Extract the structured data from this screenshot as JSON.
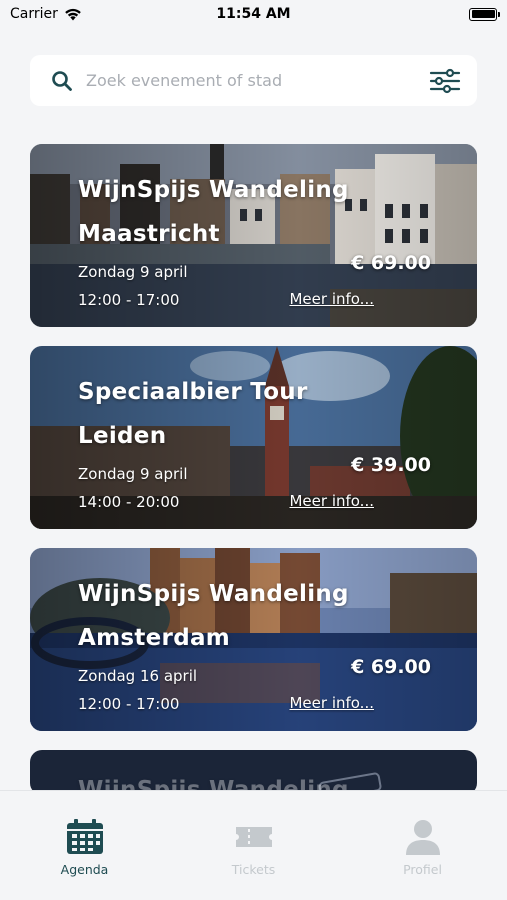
{
  "status_bar": {
    "carrier": "Carrier",
    "time": "11:54 AM"
  },
  "search": {
    "placeholder": "Zoek evenement of stad",
    "value": ""
  },
  "events": [
    {
      "title": "WijnSpijs Wandeling Maastricht",
      "date": "Zondag 9 april",
      "time": "12:00 - 17:00",
      "price": "€ 69.00",
      "more_label": "Meer info..."
    },
    {
      "title": "Speciaalbier Tour Leiden",
      "date": "Zondag 9 april",
      "time": "14:00 - 20:00",
      "price": "€ 39.00",
      "more_label": "Meer info..."
    },
    {
      "title": "WijnSpijs Wandeling Amsterdam",
      "date": "Zondag 16 april",
      "time": "12:00 - 17:00",
      "price": "€ 69.00",
      "more_label": "Meer info..."
    },
    {
      "title": "WijnSpijs Wandeling"
    }
  ],
  "tabs": [
    {
      "label": "Agenda",
      "icon": "calendar-icon",
      "active": true
    },
    {
      "label": "Tickets",
      "icon": "ticket-icon",
      "active": false
    },
    {
      "label": "Profiel",
      "icon": "profile-icon",
      "active": false
    }
  ],
  "colors": {
    "accent": "#1f4c52",
    "inactive": "#c4c9cd",
    "background": "#f4f5f7"
  }
}
